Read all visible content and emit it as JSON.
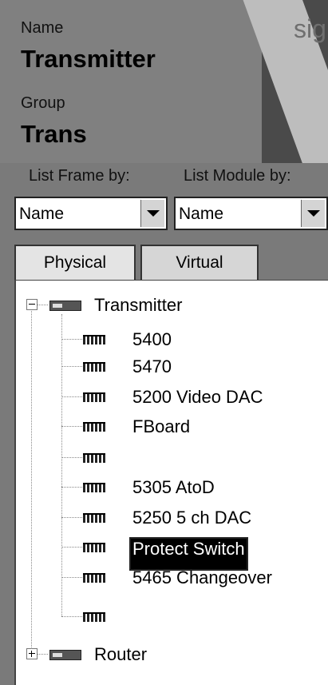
{
  "header": {
    "name_label": "Name",
    "name_value": "Transmitter",
    "group_label": "Group",
    "group_value": "Trans",
    "brand_text": "sig"
  },
  "filters": {
    "frame_label": "List Frame by:",
    "module_label": "List Module by:",
    "frame_value": "Name",
    "module_value": "Name"
  },
  "tabs": [
    {
      "label": "Physical",
      "active": true
    },
    {
      "label": "Virtual",
      "active": false
    }
  ],
  "tree": {
    "root": {
      "label": "Transmitter",
      "expanded": true
    },
    "children": [
      {
        "label": "5400"
      },
      {
        "label": "5470"
      },
      {
        "label": "5200 Video DAC"
      },
      {
        "label": "FBoard"
      },
      {
        "label": ""
      },
      {
        "label": "5305 AtoD"
      },
      {
        "label": "5250 5 ch DAC"
      },
      {
        "label": "Protect Switch",
        "selected": true
      },
      {
        "label": "5465 Changeover"
      },
      {
        "label": ""
      }
    ],
    "second_root": {
      "label": "Router",
      "expanded": false
    }
  },
  "colors": {
    "header_bg": "#808080",
    "selection_bg": "#000000",
    "selection_text": "#ffffff"
  }
}
